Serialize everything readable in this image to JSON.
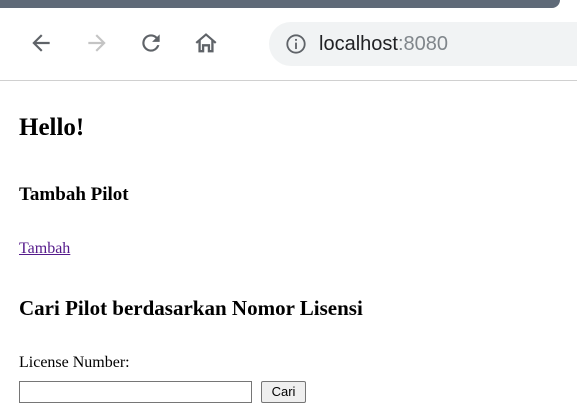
{
  "browser": {
    "url_host": "localhost",
    "url_port": ":8080",
    "icons": [
      "back-arrow-icon",
      "forward-arrow-icon",
      "reload-icon",
      "home-icon",
      "info-icon"
    ],
    "colors": {
      "forward_disabled": "#c4c4c4",
      "icon": "#5f6368",
      "omnibox_bg": "#f1f3f4"
    }
  },
  "page": {
    "greeting": "Hello!",
    "add_section_title": "Tambah Pilot",
    "add_link": "Tambah",
    "search_section_title": "Cari Pilot berdasarkan Nomor Lisensi",
    "license_label": "License Number:",
    "license_input_value": "",
    "search_button": "Cari",
    "colors": {
      "visited_link": "#551a8b"
    }
  }
}
